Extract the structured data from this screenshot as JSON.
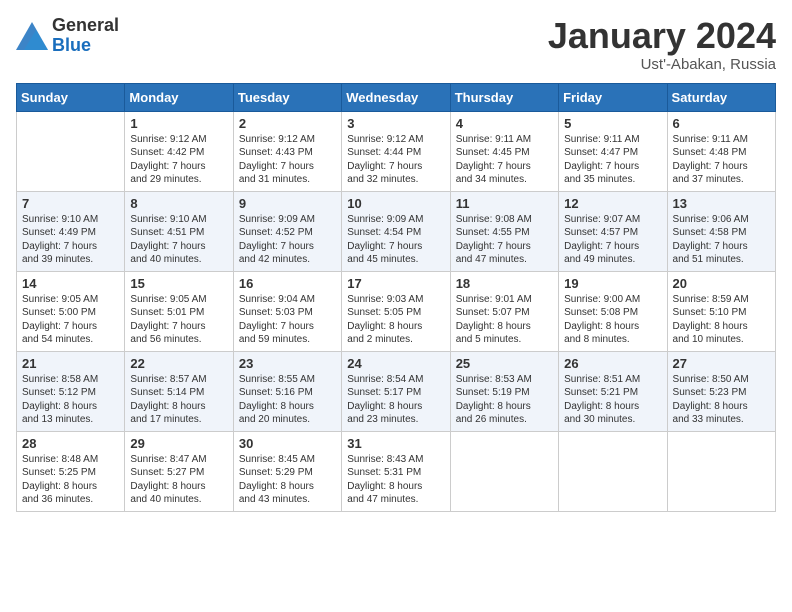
{
  "logo": {
    "general": "General",
    "blue": "Blue"
  },
  "header": {
    "month": "January 2024",
    "location": "Ust'-Abakan, Russia"
  },
  "weekdays": [
    "Sunday",
    "Monday",
    "Tuesday",
    "Wednesday",
    "Thursday",
    "Friday",
    "Saturday"
  ],
  "weeks": [
    [
      {
        "day": "",
        "info": ""
      },
      {
        "day": "1",
        "info": "Sunrise: 9:12 AM\nSunset: 4:42 PM\nDaylight: 7 hours\nand 29 minutes."
      },
      {
        "day": "2",
        "info": "Sunrise: 9:12 AM\nSunset: 4:43 PM\nDaylight: 7 hours\nand 31 minutes."
      },
      {
        "day": "3",
        "info": "Sunrise: 9:12 AM\nSunset: 4:44 PM\nDaylight: 7 hours\nand 32 minutes."
      },
      {
        "day": "4",
        "info": "Sunrise: 9:11 AM\nSunset: 4:45 PM\nDaylight: 7 hours\nand 34 minutes."
      },
      {
        "day": "5",
        "info": "Sunrise: 9:11 AM\nSunset: 4:47 PM\nDaylight: 7 hours\nand 35 minutes."
      },
      {
        "day": "6",
        "info": "Sunrise: 9:11 AM\nSunset: 4:48 PM\nDaylight: 7 hours\nand 37 minutes."
      }
    ],
    [
      {
        "day": "7",
        "info": "Sunrise: 9:10 AM\nSunset: 4:49 PM\nDaylight: 7 hours\nand 39 minutes."
      },
      {
        "day": "8",
        "info": "Sunrise: 9:10 AM\nSunset: 4:51 PM\nDaylight: 7 hours\nand 40 minutes."
      },
      {
        "day": "9",
        "info": "Sunrise: 9:09 AM\nSunset: 4:52 PM\nDaylight: 7 hours\nand 42 minutes."
      },
      {
        "day": "10",
        "info": "Sunrise: 9:09 AM\nSunset: 4:54 PM\nDaylight: 7 hours\nand 45 minutes."
      },
      {
        "day": "11",
        "info": "Sunrise: 9:08 AM\nSunset: 4:55 PM\nDaylight: 7 hours\nand 47 minutes."
      },
      {
        "day": "12",
        "info": "Sunrise: 9:07 AM\nSunset: 4:57 PM\nDaylight: 7 hours\nand 49 minutes."
      },
      {
        "day": "13",
        "info": "Sunrise: 9:06 AM\nSunset: 4:58 PM\nDaylight: 7 hours\nand 51 minutes."
      }
    ],
    [
      {
        "day": "14",
        "info": "Sunrise: 9:05 AM\nSunset: 5:00 PM\nDaylight: 7 hours\nand 54 minutes."
      },
      {
        "day": "15",
        "info": "Sunrise: 9:05 AM\nSunset: 5:01 PM\nDaylight: 7 hours\nand 56 minutes."
      },
      {
        "day": "16",
        "info": "Sunrise: 9:04 AM\nSunset: 5:03 PM\nDaylight: 7 hours\nand 59 minutes."
      },
      {
        "day": "17",
        "info": "Sunrise: 9:03 AM\nSunset: 5:05 PM\nDaylight: 8 hours\nand 2 minutes."
      },
      {
        "day": "18",
        "info": "Sunrise: 9:01 AM\nSunset: 5:07 PM\nDaylight: 8 hours\nand 5 minutes."
      },
      {
        "day": "19",
        "info": "Sunrise: 9:00 AM\nSunset: 5:08 PM\nDaylight: 8 hours\nand 8 minutes."
      },
      {
        "day": "20",
        "info": "Sunrise: 8:59 AM\nSunset: 5:10 PM\nDaylight: 8 hours\nand 10 minutes."
      }
    ],
    [
      {
        "day": "21",
        "info": "Sunrise: 8:58 AM\nSunset: 5:12 PM\nDaylight: 8 hours\nand 13 minutes."
      },
      {
        "day": "22",
        "info": "Sunrise: 8:57 AM\nSunset: 5:14 PM\nDaylight: 8 hours\nand 17 minutes."
      },
      {
        "day": "23",
        "info": "Sunrise: 8:55 AM\nSunset: 5:16 PM\nDaylight: 8 hours\nand 20 minutes."
      },
      {
        "day": "24",
        "info": "Sunrise: 8:54 AM\nSunset: 5:17 PM\nDaylight: 8 hours\nand 23 minutes."
      },
      {
        "day": "25",
        "info": "Sunrise: 8:53 AM\nSunset: 5:19 PM\nDaylight: 8 hours\nand 26 minutes."
      },
      {
        "day": "26",
        "info": "Sunrise: 8:51 AM\nSunset: 5:21 PM\nDaylight: 8 hours\nand 30 minutes."
      },
      {
        "day": "27",
        "info": "Sunrise: 8:50 AM\nSunset: 5:23 PM\nDaylight: 8 hours\nand 33 minutes."
      }
    ],
    [
      {
        "day": "28",
        "info": "Sunrise: 8:48 AM\nSunset: 5:25 PM\nDaylight: 8 hours\nand 36 minutes."
      },
      {
        "day": "29",
        "info": "Sunrise: 8:47 AM\nSunset: 5:27 PM\nDaylight: 8 hours\nand 40 minutes."
      },
      {
        "day": "30",
        "info": "Sunrise: 8:45 AM\nSunset: 5:29 PM\nDaylight: 8 hours\nand 43 minutes."
      },
      {
        "day": "31",
        "info": "Sunrise: 8:43 AM\nSunset: 5:31 PM\nDaylight: 8 hours\nand 47 minutes."
      },
      {
        "day": "",
        "info": ""
      },
      {
        "day": "",
        "info": ""
      },
      {
        "day": "",
        "info": ""
      }
    ]
  ]
}
